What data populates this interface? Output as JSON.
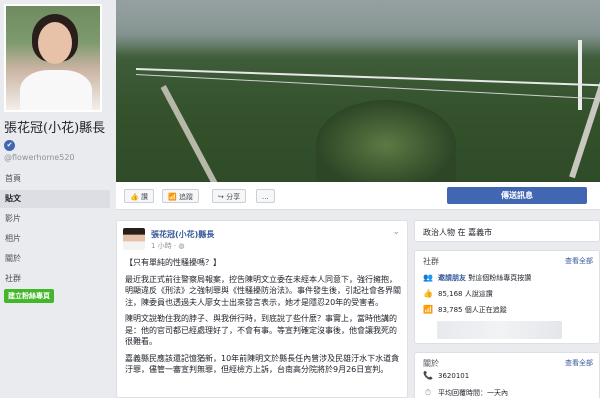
{
  "page": {
    "name": "張花冠(小花)縣長",
    "verified_mark": "✔",
    "handle": "@flowerhome520"
  },
  "nav": {
    "items": [
      "首頁",
      "貼文",
      "影片",
      "相片",
      "關於",
      "社群"
    ],
    "active": "貼文",
    "create_page": "建立粉絲專頁"
  },
  "actions": {
    "like": "讚",
    "follow": "追蹤",
    "share": "分享",
    "more": "...",
    "send_message": "傳送訊息"
  },
  "post": {
    "author": "張花冠(小花)縣長",
    "time": "1 小時",
    "paragraphs": [
      "【只有單純的性騷擾嗎？】",
      "最近我正式前往警察局報案，控告陳明文立委在未經本人同意下，強行擁抱，明顯違反《刑法》之強制罪與《性騷擾防治法》。事件發生後，引起社會各界關注，陳委員也透過夫人廖女士出來發言表示，她才是隱忍20年的受害者。",
      "陳明文說勒住我的脖子、與我併行時，到底說了些什麼？事實上，當時他講的是：他的官司都已經處理好了，不會有事。等宣判確定沒事後，他會讓我死的很難看。",
      "嘉義縣民應該還記憶猶新，10年前陳明文於縣長任內曾涉及民雄汙水下水道貪汙罪，儘管一審宣判無罪，但經檢方上訴，台南高分院將於9月26日宣判。"
    ]
  },
  "sidebar": {
    "category": "政治人物 在 嘉義市",
    "community": {
      "heading": "社群",
      "see_all": "查看全部",
      "invite_link": "邀請朋友",
      "invite_rest": "對這個粉絲專頁按讚",
      "likes": "85,168 人說這讚",
      "follows": "83,785 個人正在追蹤"
    },
    "about": {
      "heading": "關於",
      "see_all": "查看全部",
      "phone": "3620101",
      "response": "平均回覆時間：一天內"
    }
  },
  "icons": {
    "like": "👍",
    "follow": "📶",
    "share": "↪",
    "invite": "👥",
    "likes": "👍",
    "follows": "📶",
    "phone": "📞",
    "response": "⏱"
  },
  "colors": {
    "brand_blue": "#4267b2",
    "link_blue": "#365899",
    "create_green": "#42b72a",
    "background": "#e9ebee"
  }
}
